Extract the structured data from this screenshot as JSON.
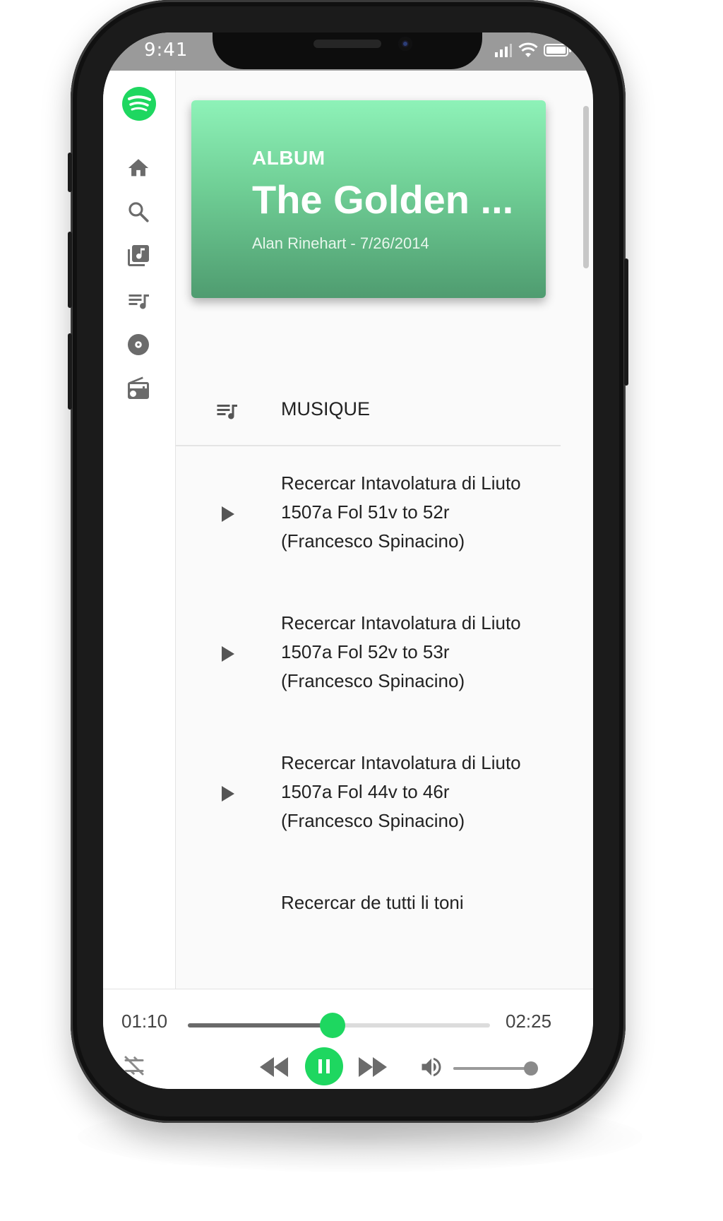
{
  "status_bar": {
    "time": "9:41"
  },
  "sidebar": {
    "items": [
      {
        "icon": "home-icon"
      },
      {
        "icon": "search-icon"
      },
      {
        "icon": "library-music-icon"
      },
      {
        "icon": "queue-music-icon"
      },
      {
        "icon": "album-disc-icon"
      },
      {
        "icon": "radio-icon"
      }
    ]
  },
  "album": {
    "type_label": "ALBUM",
    "title": "The Golden ...",
    "subtitle": "Alan Rinehart - 7/26/2014"
  },
  "tracklist": {
    "header_label": "MUSIQUE",
    "tracks": [
      {
        "title": "Recercar Intavolatura di Liuto 1507a Fol 51v to 52r (Francesco Spinacino)"
      },
      {
        "title": "Recercar Intavolatura di Liuto 1507a Fol 52v to 53r (Francesco Spinacino)"
      },
      {
        "title": "Recercar Intavolatura di Liuto 1507a Fol 44v to 46r (Francesco Spinacino)"
      },
      {
        "title": "Recercar de tutti li toni"
      }
    ]
  },
  "player": {
    "current_time": "01:10",
    "total_time": "02:25",
    "progress": 0.48,
    "volume": 1.0,
    "is_playing": true
  },
  "colors": {
    "accent": "#1ed760",
    "album_gradient_top": "#8ef2b8",
    "album_gradient_bottom": "#4f9c70",
    "icon_gray": "#6b6b6b"
  }
}
